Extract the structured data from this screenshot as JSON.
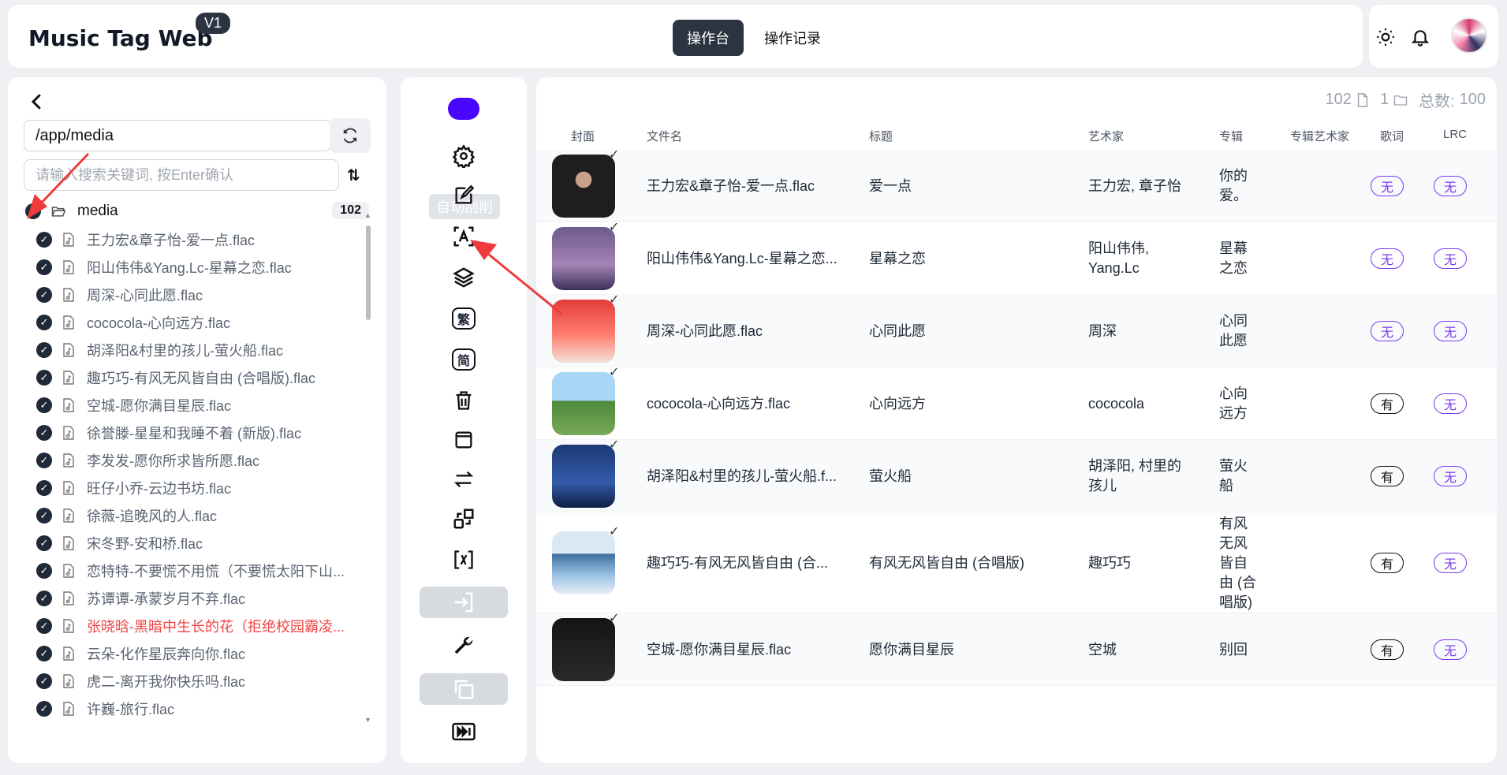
{
  "app": {
    "title": "Music Tag Web",
    "version": "V1"
  },
  "nav": {
    "tabs": [
      {
        "label": "操作台"
      },
      {
        "label": "操作记录"
      }
    ]
  },
  "colors": {
    "accent": "#2b3440",
    "purple": "#7c3aed",
    "chip": "#4a07ff",
    "error": "#ef4444"
  },
  "left": {
    "path_value": "/app/media",
    "search_placeholder": "请输入搜索关键词, 按Enter确认",
    "sort_label": "⇅",
    "root": {
      "label": "media",
      "count": "102"
    },
    "files": [
      {
        "name": "王力宏&章子怡-爱一点.flac"
      },
      {
        "name": "阳山伟伟&Yang.Lc-星幕之恋.flac"
      },
      {
        "name": "周深-心同此愿.flac"
      },
      {
        "name": "cococola-心向远方.flac"
      },
      {
        "name": "胡泽阳&村里的孩儿-萤火船.flac"
      },
      {
        "name": "趣巧巧-有风无风皆自由 (合唱版).flac"
      },
      {
        "name": "空城-愿你满目星辰.flac"
      },
      {
        "name": "徐誉滕-星星和我睡不着 (新版).flac"
      },
      {
        "name": "李发发-愿你所求皆所愿.flac"
      },
      {
        "name": "旺仔小乔-云边书坊.flac"
      },
      {
        "name": "徐薇-追晚风的人.flac"
      },
      {
        "name": "宋冬野-安和桥.flac"
      },
      {
        "name": "恋特特-不要慌不用慌（不要慌太阳下山..."
      },
      {
        "name": "苏谭谭-承蒙岁月不弃.flac"
      },
      {
        "name": "张晓晗-黑暗中生长的花（拒绝校园霸凌..."
      },
      {
        "name": "云朵-化作星辰奔向你.flac"
      },
      {
        "name": "虎二-离开我你快乐吗.flac"
      },
      {
        "name": "许巍-旅行.flac"
      }
    ]
  },
  "tools": {
    "tooltip": "自动刮削",
    "trad_label": "繁",
    "simp_label": "简"
  },
  "table": {
    "summary": {
      "files": "102",
      "folders": "1",
      "total_label": "总数:",
      "total": "100"
    },
    "headers": {
      "cover": "封面",
      "filename": "文件名",
      "title": "标题",
      "artist": "艺术家",
      "album": "专辑",
      "album_artist": "专辑艺术家",
      "lyrics": "歌词",
      "lrc": "LRC"
    },
    "rows": [
      {
        "filename": "王力宏&章子怡-爱一点.flac",
        "title": "爱一点",
        "artist": "王力宏, 章子怡",
        "album_l1": "你的",
        "album_l2": "爱。",
        "album_l3": "",
        "album_l4": "",
        "album_l5": "",
        "lyrics": "无",
        "lrc": "无",
        "tick": "✓"
      },
      {
        "filename": "阳山伟伟&Yang.Lc-星幕之恋...",
        "title": "星幕之恋",
        "artist_l1": "阳山伟伟,",
        "artist_l2": "Yang.Lc",
        "album_l1": "星幕",
        "album_l2": "之恋",
        "lyrics": "无",
        "lrc": "无",
        "tick": "✓"
      },
      {
        "filename": "周深-心同此愿.flac",
        "title": "心同此愿",
        "artist": "周深",
        "album_l1": "心同",
        "album_l2": "此愿",
        "lyrics": "无",
        "lrc": "无",
        "tick": "✓"
      },
      {
        "filename": "cococola-心向远方.flac",
        "title": "心向远方",
        "artist": "cococola",
        "album_l1": "心向",
        "album_l2": "远方",
        "lyrics": "有",
        "lrc": "无",
        "tick": "✓"
      },
      {
        "filename": "胡泽阳&村里的孩儿-萤火船.f...",
        "title": "萤火船",
        "artist_l1": "胡泽阳, 村里的",
        "artist_l2": "孩儿",
        "album_l1": "萤火",
        "album_l2": "船",
        "lyrics": "有",
        "lrc": "无",
        "tick": "✓"
      },
      {
        "filename": "趣巧巧-有风无风皆自由 (合...",
        "title": "有风无风皆自由 (合唱版)",
        "artist": "趣巧巧",
        "album_l1": "有风",
        "album_l2": "无风",
        "album_l3": "皆自",
        "album_l4": "由 (合",
        "album_l5": "唱版)",
        "lyrics": "有",
        "lrc": "无",
        "tick": "✓"
      },
      {
        "filename": "空城-愿你满目星辰.flac",
        "title": "愿你满目星辰",
        "artist": "空城",
        "album_l1": "别回",
        "lyrics": "有",
        "lrc": "无",
        "tick": "✓"
      }
    ]
  }
}
